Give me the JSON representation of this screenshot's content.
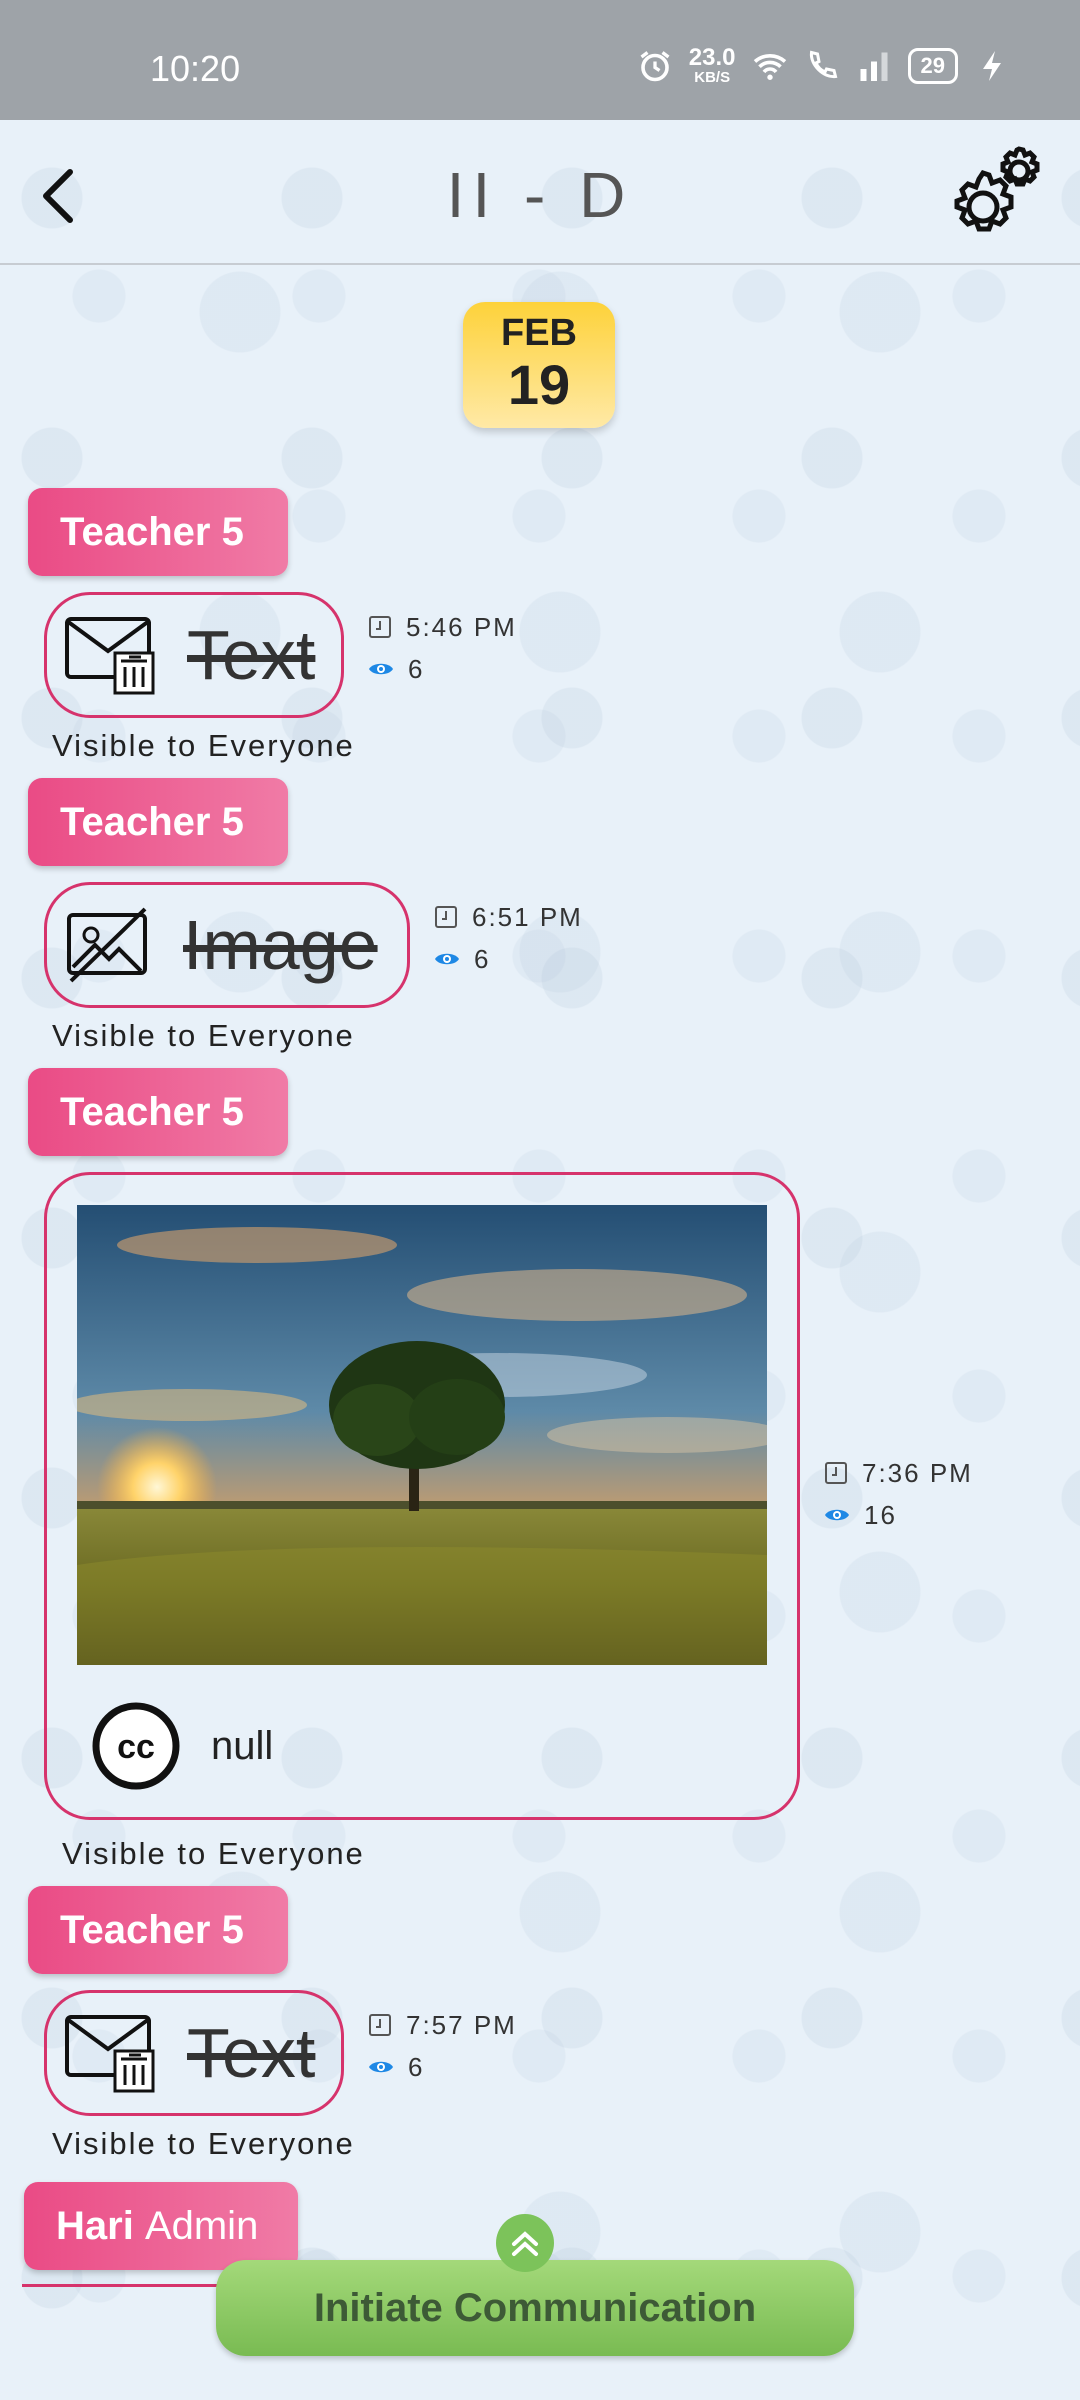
{
  "status_bar": {
    "time": "10:20",
    "net_speed": "23.0",
    "net_unit": "KB/S",
    "battery": "29",
    "icons": [
      "alarm-icon",
      "wifi-icon",
      "call-icon",
      "signal-icon",
      "charging-icon"
    ]
  },
  "header": {
    "title": "II - D",
    "back_icon": "chevron-left-icon",
    "settings_icon": "gear-icon"
  },
  "date_chip": {
    "month": "FEB",
    "day": "19"
  },
  "messages": [
    {
      "sender": "Teacher 5",
      "type_label": "Text",
      "icon": "mail-delete-icon",
      "time": "5:46 PM",
      "views": "6",
      "visibility": "Visible to Everyone"
    },
    {
      "sender": "Teacher 5",
      "type_label": "Image",
      "icon": "image-off-icon",
      "time": "6:51 PM",
      "views": "6",
      "visibility": "Visible to Everyone"
    },
    {
      "sender": "Teacher 5",
      "type_label": "",
      "icon": "photo",
      "caption": "null",
      "time": "7:36 PM",
      "views": "16",
      "visibility": "Visible to Everyone"
    },
    {
      "sender": "Teacher 5",
      "type_label": "Text",
      "icon": "mail-delete-icon",
      "time": "7:57 PM",
      "views": "6",
      "visibility": "Visible to Everyone"
    }
  ],
  "last_sender": {
    "name": "Hari",
    "role": "Admin"
  },
  "cta": {
    "label": "Initiate Communication"
  },
  "colors": {
    "accent": "#d6336c",
    "chip": "#fdd23a",
    "cta": "#8cc963",
    "eye": "#1e88e5"
  }
}
